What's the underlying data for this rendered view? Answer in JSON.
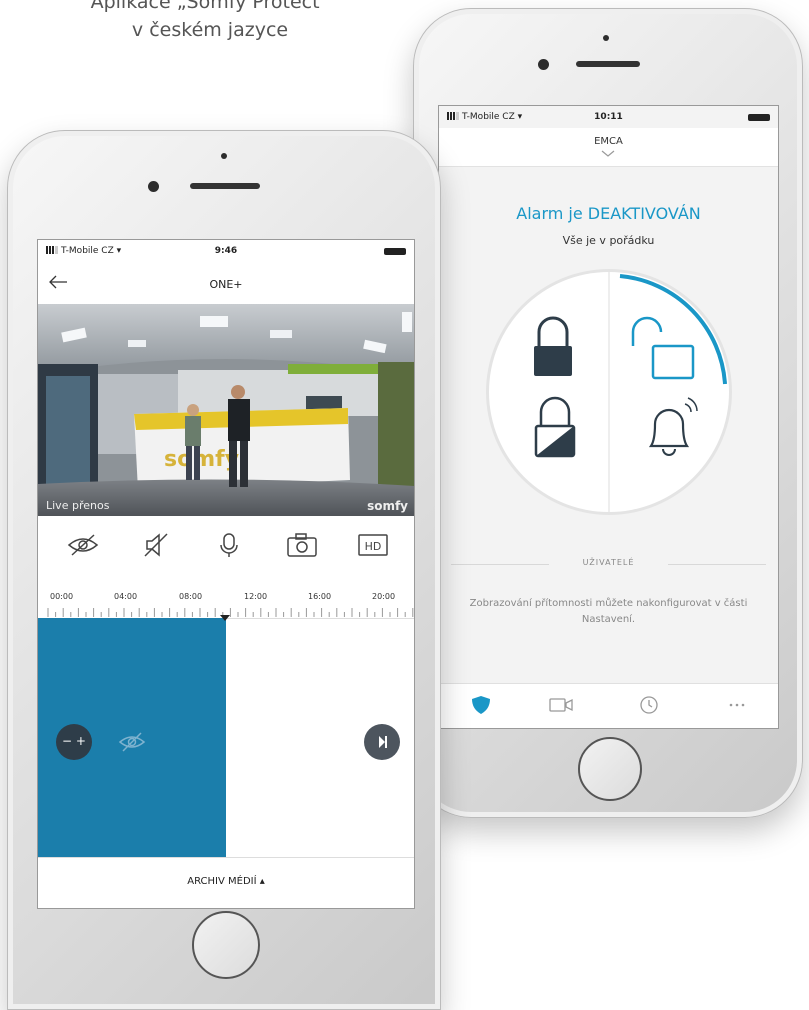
{
  "caption": {
    "line1": "Aplikace „Somfy Protect“",
    "line2": "v českém jazyce"
  },
  "alarm_phone": {
    "status_bar": {
      "carrier": "T-Mobile CZ",
      "time": "10:11"
    },
    "header_title": "EMCA",
    "alarm_title": "Alarm je DEAKTIVOVÁN",
    "alarm_subtitle": "Vše je v pořádku",
    "modes": [
      {
        "icon": "lock-closed-icon"
      },
      {
        "icon": "lock-open-icon",
        "active": true
      },
      {
        "icon": "lock-partial-icon"
      },
      {
        "icon": "bell-icon"
      }
    ],
    "users_label": "UŽIVATELÉ",
    "users_info": "Zobrazování přítomnosti můžete nakonfigurovat v části Nastavení.",
    "tabs": [
      {
        "icon": "shield-icon",
        "active": true
      },
      {
        "icon": "video-camera-icon"
      },
      {
        "icon": "history-clock-icon"
      },
      {
        "icon": "more-dots-icon"
      }
    ],
    "colors": {
      "accent": "#1a97c7"
    }
  },
  "camera_phone": {
    "status_bar": {
      "carrier": "T-Mobile CZ",
      "time": "9:46"
    },
    "header_title": "ONE+",
    "video": {
      "live_label": "Live přenos",
      "watermark": "somfy",
      "scene_text": "somfy"
    },
    "controls": [
      {
        "icon": "privacy-eye-off-icon"
      },
      {
        "icon": "mute-speaker-icon"
      },
      {
        "icon": "microphone-icon"
      },
      {
        "icon": "snapshot-camera-icon"
      },
      {
        "icon": "hd-quality-icon"
      }
    ],
    "hd_label": "HD",
    "timeline_labels": [
      "00:00",
      "04:00",
      "08:00",
      "12:00",
      "16:00",
      "20:00"
    ],
    "zoom_label": "− +",
    "archive_label": "ARCHIV MÉDIÍ ▴",
    "colors": {
      "timeline_fill": "#1b7eab"
    }
  }
}
